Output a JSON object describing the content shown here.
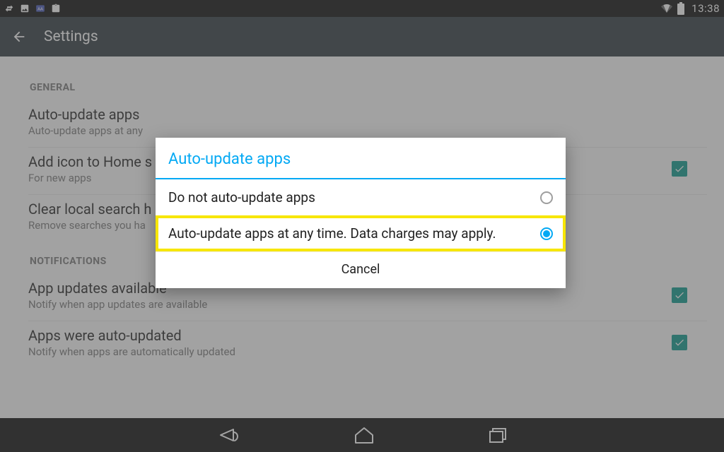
{
  "status": {
    "time": "13:38"
  },
  "appbar": {
    "title": "Settings"
  },
  "sections": {
    "general": {
      "header": "GENERAL",
      "auto_update": {
        "title": "Auto-update apps",
        "sub": "Auto-update apps at any"
      },
      "add_icon": {
        "title": "Add icon to Home s",
        "sub": "For new apps"
      },
      "clear_search": {
        "title": "Clear local search h",
        "sub": "Remove searches you ha"
      }
    },
    "notifications": {
      "header": "NOTIFICATIONS",
      "updates_avail": {
        "title": "App updates available",
        "sub": "Notify when app updates are available"
      },
      "auto_updated": {
        "title": "Apps were auto-updated",
        "sub": "Notify when apps are automatically updated"
      }
    }
  },
  "dialog": {
    "title": "Auto-update apps",
    "option1": "Do not auto-update apps",
    "option2": "Auto-update apps at any time. Data charges may apply.",
    "cancel": "Cancel",
    "selected_index": 1
  },
  "colors": {
    "accent": "#03a9f4",
    "teal": "#009688",
    "appbar": "#263238",
    "highlight": "#f7e600"
  }
}
